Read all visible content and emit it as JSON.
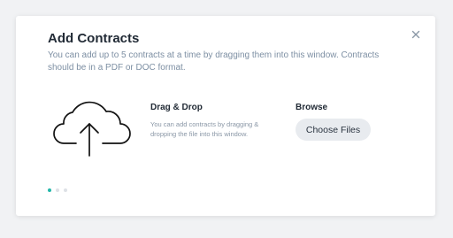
{
  "dialog": {
    "title": "Add Contracts",
    "subtitle": "You can add up to 5 contracts at a time by dragging them into this window. Contracts should be in a PDF or DOC format.",
    "close_icon": "close-icon"
  },
  "drag_drop": {
    "icon": "cloud-upload-icon",
    "heading": "Drag & Drop",
    "description": "You can add contracts by dragging & dropping the file into this window."
  },
  "browse": {
    "heading": "Browse",
    "button_label": "Choose Files"
  },
  "pagination": {
    "total": 3,
    "active_index": 0,
    "active_color": "#23b7a9",
    "inactive_color": "#dde1e6"
  }
}
